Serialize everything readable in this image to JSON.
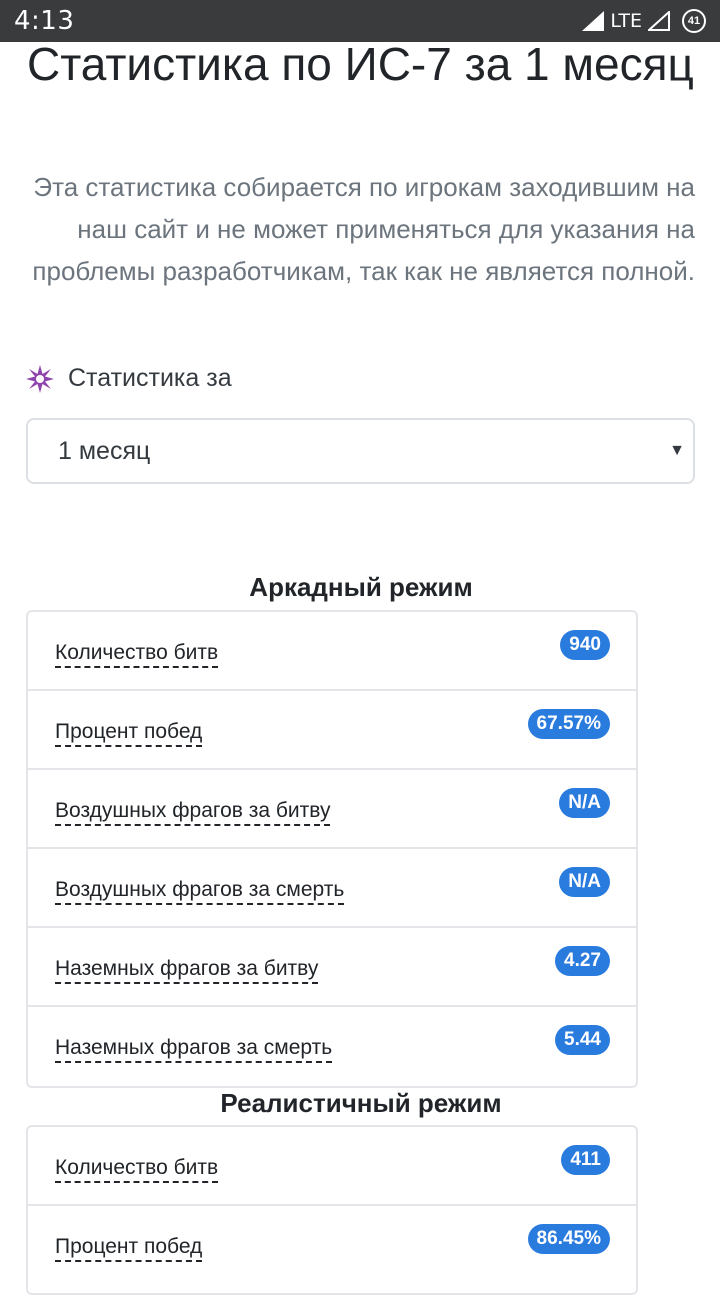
{
  "status_bar": {
    "time": "4:13",
    "network": "LTE",
    "battery": "41"
  },
  "page": {
    "title": "Статистика по ИС-7 за 1 месяц",
    "lead": "Эта статистика собирается по игрокам заходившим на наш сайт и не может применяться для указания на проблемы разработчикам, так как не является полной.",
    "period_label": "Статистика за",
    "period_icon": "purple-star-icon",
    "period_value": "1 месяц"
  },
  "arcade": {
    "title": "Аркадный режим",
    "rows": [
      {
        "label": "Количество битв",
        "value": "940"
      },
      {
        "label": "Процент побед",
        "value": "67.57%"
      },
      {
        "label": "Воздушных фрагов за битву",
        "value": "N/A"
      },
      {
        "label": "Воздушных фрагов за смерть",
        "value": "N/A"
      },
      {
        "label": "Наземных фрагов за битву",
        "value": "4.27"
      },
      {
        "label": "Наземных фрагов за смерть",
        "value": "5.44"
      }
    ]
  },
  "realistic": {
    "title": "Реалистичный режим",
    "rows": [
      {
        "label": "Количество битв",
        "value": "411"
      },
      {
        "label": "Процент побед",
        "value": "86.45%"
      }
    ]
  },
  "colors": {
    "badge": "#2a7bde",
    "status_bar": "#3a3b3d",
    "icon": "#8e44ad"
  }
}
